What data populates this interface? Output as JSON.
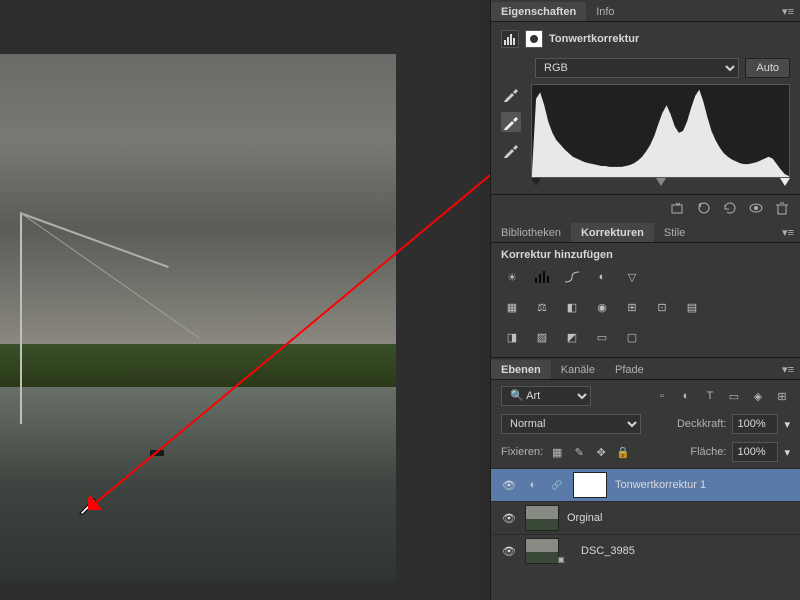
{
  "properties_panel": {
    "tabs": [
      "Eigenschaften",
      "Info"
    ],
    "active_tab": 0,
    "adjustment_title": "Tonwertkorrektur",
    "channel": "RGB",
    "auto_label": "Auto"
  },
  "chart_data": {
    "type": "area",
    "title": "",
    "xlabel": "",
    "ylabel": "",
    "xlim": [
      0,
      255
    ],
    "ylim": [
      0,
      100
    ],
    "series": [
      {
        "name": "luminance",
        "values": [
          5,
          85,
          92,
          78,
          60,
          48,
          40,
          35,
          30,
          26,
          22,
          20,
          18,
          16,
          15,
          14,
          13,
          12,
          12,
          11,
          11,
          11,
          11,
          12,
          13,
          15,
          18,
          22,
          28,
          35,
          45,
          58,
          70,
          78,
          68,
          55,
          48,
          50,
          60,
          75,
          88,
          95,
          82,
          65,
          50,
          40,
          32,
          26,
          22,
          19,
          17,
          15,
          14,
          14,
          15,
          16,
          18,
          20,
          22,
          20,
          14,
          8,
          3,
          1
        ]
      }
    ]
  },
  "libraries_panel": {
    "tabs": [
      "Bibliotheken",
      "Korrekturen",
      "Stile"
    ],
    "active_tab": 1,
    "heading": "Korrektur hinzufügen"
  },
  "layers_panel": {
    "tabs": [
      "Ebenen",
      "Kanäle",
      "Pfade"
    ],
    "active_tab": 0,
    "filter_label": "Art",
    "blend_mode": "Normal",
    "opacity_label": "Deckkraft:",
    "opacity_value": "100%",
    "lock_label": "Fixieren:",
    "fill_label": "Fläche:",
    "fill_value": "100%",
    "layers": [
      {
        "name": "Tonwertkorrektur 1",
        "type": "adjustment",
        "selected": true
      },
      {
        "name": "Orginal",
        "type": "image",
        "selected": false
      },
      {
        "name": "DSC_3985",
        "type": "image",
        "selected": false
      }
    ]
  }
}
